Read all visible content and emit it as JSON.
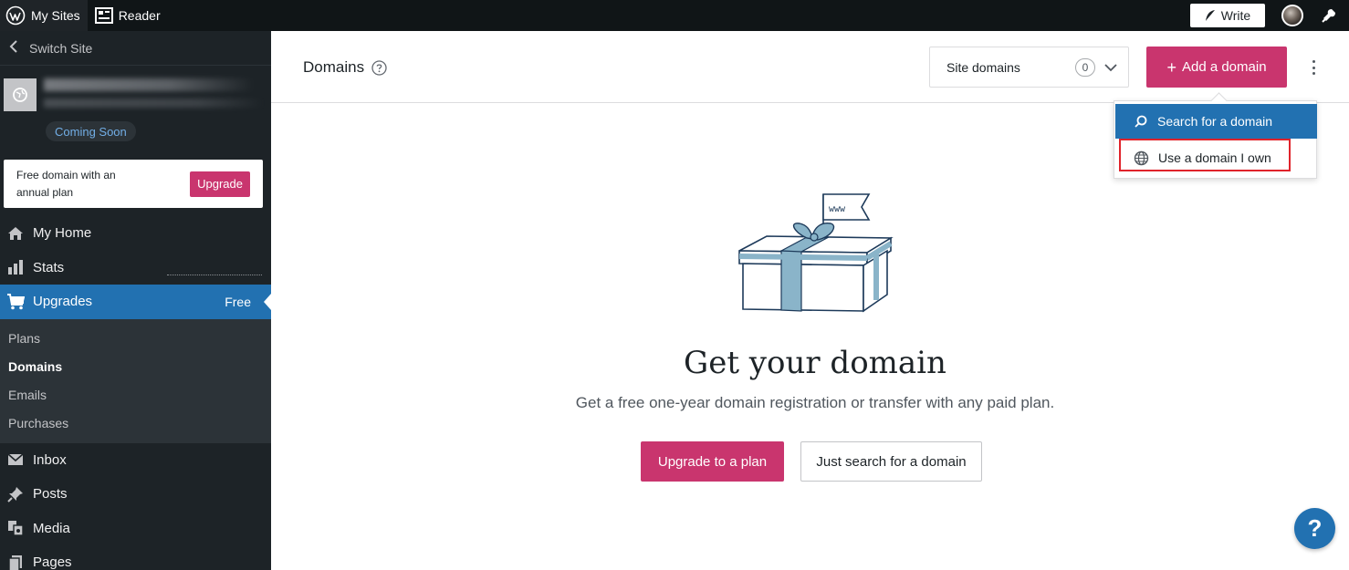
{
  "topbar": {
    "my_sites": "My Sites",
    "reader": "Reader",
    "write": "Write"
  },
  "sidebar": {
    "switch_site": "Switch Site",
    "site_status": "Coming Soon",
    "upsell_text": "Free domain with an annual plan",
    "upsell_button": "Upgrade",
    "items": [
      {
        "label": "My Home",
        "icon": "home-icon"
      },
      {
        "label": "Stats",
        "icon": "stats-icon"
      },
      {
        "label": "Upgrades",
        "icon": "cart-icon",
        "badge": "Free",
        "active": true
      }
    ],
    "submenu": [
      {
        "label": "Plans"
      },
      {
        "label": "Domains",
        "current": true
      },
      {
        "label": "Emails"
      },
      {
        "label": "Purchases"
      }
    ],
    "items_after": [
      {
        "label": "Inbox",
        "icon": "inbox-icon"
      },
      {
        "label": "Posts",
        "icon": "pin-icon"
      },
      {
        "label": "Media",
        "icon": "media-icon"
      },
      {
        "label": "Pages",
        "icon": "pages-icon"
      }
    ]
  },
  "header": {
    "title": "Domains",
    "site_domains_label": "Site domains",
    "site_domains_count": "0",
    "add_domain_label": "Add a domain"
  },
  "dropdown": {
    "search_label": "Search for a domain",
    "own_label": "Use a domain I own"
  },
  "empty_state": {
    "illustration_flag": "www",
    "title": "Get your domain",
    "subtitle": "Get a free one-year domain registration or transfer with any paid plan.",
    "primary_button": "Upgrade to a plan",
    "secondary_button": "Just search for a domain"
  },
  "help_fab": "?",
  "colors": {
    "accent": "#c9356e",
    "blue": "#2271b1",
    "sidebar": "#1d2327",
    "topbar": "#101517",
    "highlight_outline": "#e0232b"
  }
}
